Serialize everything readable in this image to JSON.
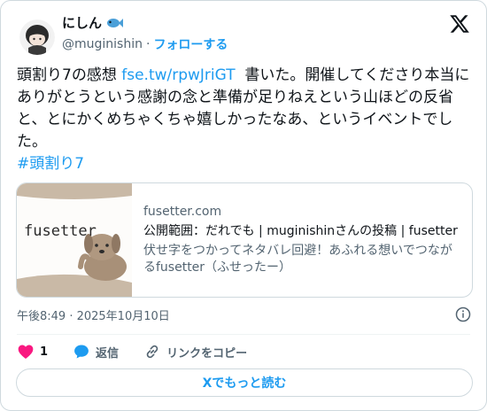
{
  "author": {
    "display_name": "にしん",
    "handle": "@muginishin",
    "follow_label": "フォローする",
    "name_emoji_icon": "fish-icon"
  },
  "tweet": {
    "text_before_link": "頭割り7の感想 ",
    "link_text": "fse.tw/rpwJriGT",
    "text_after_link": "  書いた。開催してくださり本当にありがとうという感謝の念と準備が足りねえという山ほどの反省と、とにかくめちゃくちゃ嬉しかったなあ、というイベントでした。",
    "hashtag": "#頭割り7"
  },
  "link_card": {
    "thumb_text": "fusetter",
    "domain": "fusetter.com",
    "title": "公開範囲：だれでも | muginishinさんの投稿 | fusetter",
    "description": "伏せ字をつかってネタバレ回避！あふれる想いでつながるfusetter（ふせったー）"
  },
  "meta": {
    "timestamp": "午後8:49 · 2025年10月10日"
  },
  "actions": {
    "like_count": "1",
    "reply_label": "返信",
    "copy_link_label": "リンクをコピー"
  },
  "footer": {
    "read_more_label": "Xでもっと読む"
  },
  "colors": {
    "accent": "#1d9bf0",
    "like": "#f91880",
    "text": "#0f1419",
    "muted": "#536471"
  }
}
